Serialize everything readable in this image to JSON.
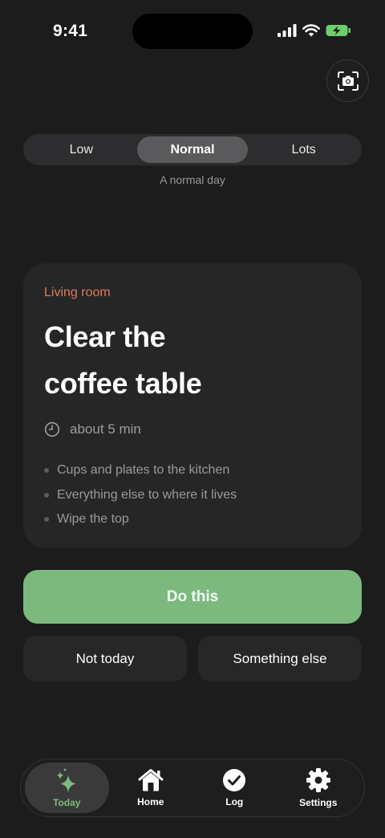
{
  "status_bar": {
    "time": "9:41"
  },
  "effort": {
    "options": [
      "Low",
      "Normal",
      "Lots"
    ],
    "selected": "Normal",
    "caption": "A normal day"
  },
  "task": {
    "room": "Living room",
    "title_line1": "Clear the",
    "title_line2": "coffee table",
    "duration": "about 5 min",
    "steps": [
      "Cups and plates to the kitchen",
      "Everything else to where it lives",
      "Wipe the top"
    ]
  },
  "actions": {
    "primary": "Do this",
    "not_today": "Not today",
    "something_else": "Something else"
  },
  "tab_bar": {
    "tabs": [
      {
        "label": "Today",
        "icon": "sparkles-icon",
        "active": true
      },
      {
        "label": "Home",
        "icon": "house-icon",
        "active": false
      },
      {
        "label": "Log",
        "icon": "checkmark-circle-icon",
        "active": false
      },
      {
        "label": "Settings",
        "icon": "gear-icon",
        "active": false
      }
    ]
  },
  "colors": {
    "accent": "#7cb97f",
    "room_label": "#e0795a",
    "background": "#1c1c1c"
  }
}
